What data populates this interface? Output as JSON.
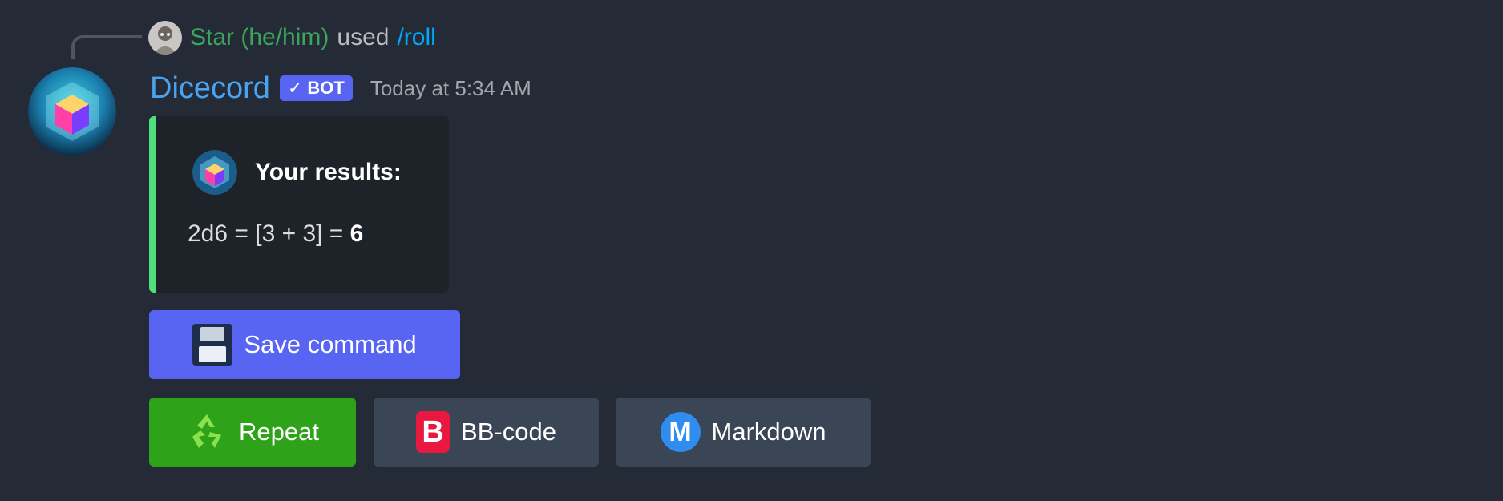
{
  "reply": {
    "user": "Star (he/him)",
    "used_text": "used",
    "command": "/roll"
  },
  "message": {
    "author": "Dicecord",
    "bot_tag": "BOT",
    "bot_check": "✓",
    "timestamp": "Today at 5:34 AM"
  },
  "embed": {
    "accent_color": "#4fe07a",
    "title": "Your results:",
    "result_expression": "2d6 = [3 + 3] = ",
    "result_total": "6"
  },
  "buttons": {
    "save": "Save command",
    "repeat": "Repeat",
    "bbcode": "BB-code",
    "bbcode_icon": "B",
    "markdown": "Markdown",
    "markdown_icon": "M"
  },
  "colors": {
    "background": "#252b36",
    "primary_button": "#5865f2",
    "success_button": "#2ea31a",
    "secondary_button": "#3a4655",
    "username_green": "#3ba55d",
    "command_blue": "#00a8fc",
    "bot_name_blue": "#4aa3f0"
  },
  "icons": [
    "avatar-icon",
    "floppy-disk-icon",
    "recycle-icon",
    "bbcode-icon",
    "markdown-icon"
  ]
}
